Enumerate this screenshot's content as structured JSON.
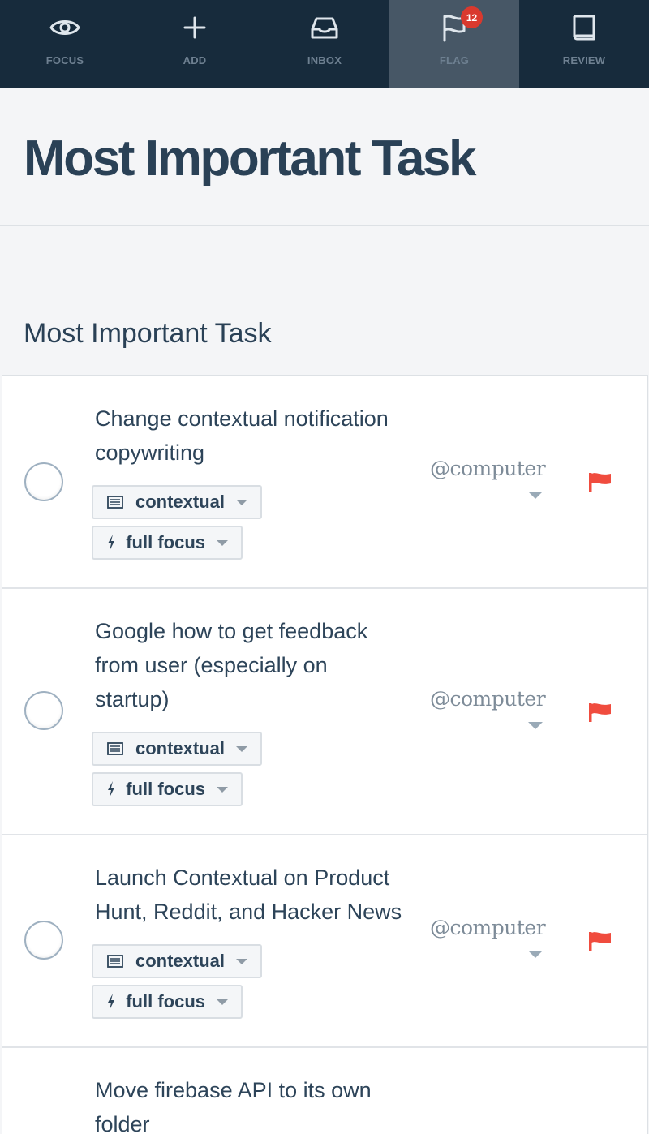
{
  "nav": {
    "items": [
      {
        "label": "FOCUS",
        "icon": "eye-icon"
      },
      {
        "label": "ADD",
        "icon": "plus-icon"
      },
      {
        "label": "INBOX",
        "icon": "inbox-icon"
      },
      {
        "label": "FLAG",
        "icon": "flag-icon",
        "badge": "12",
        "active": true
      },
      {
        "label": "REVIEW",
        "icon": "book-icon"
      }
    ]
  },
  "page": {
    "title": "Most Important Task",
    "section_title": "Most Important Task"
  },
  "tasks": [
    {
      "title_lines": [
        "Change contextual notification",
        "copywriting"
      ],
      "context": "contextual",
      "energy": "full focus",
      "tag": "@computer",
      "flagged": true
    },
    {
      "title_lines": [
        "Google how to get feedback",
        "from user (especially on",
        "startup)"
      ],
      "context": "contextual",
      "energy": "full focus",
      "tag": "@computer",
      "flagged": true
    },
    {
      "title_lines": [
        "Launch Contextual on Product",
        "Hunt, Reddit, and Hacker News"
      ],
      "context": "contextual",
      "energy": "full focus",
      "tag": "@computer",
      "flagged": true
    },
    {
      "title_lines": [
        "Move firebase API to its own",
        "folder"
      ],
      "context": "",
      "energy": "",
      "tag": "",
      "flagged": false
    }
  ],
  "colors": {
    "nav_bg": "#172b3c",
    "nav_active_bg": "#475766",
    "badge": "#d9392e",
    "flag": "#f04c3e",
    "text": "#2d4459"
  }
}
